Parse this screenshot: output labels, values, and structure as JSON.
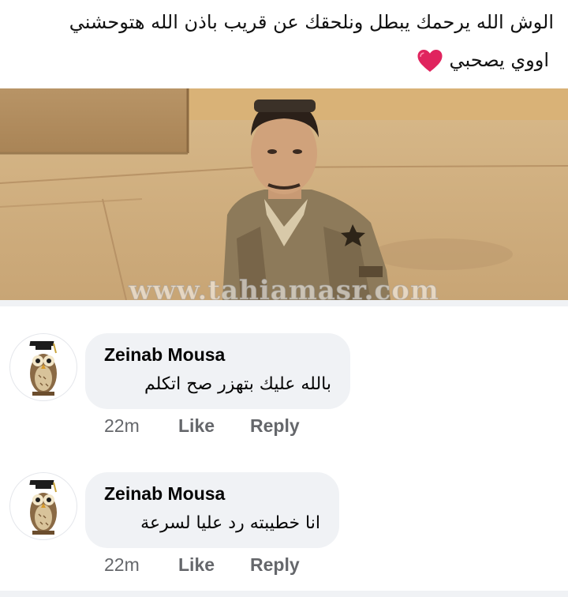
{
  "post": {
    "text_line1": "الوش  الله يرحمك يبطل ونلحقك عن قريب باذن الله هتوحشني",
    "text_line2": "اووي يصحبي",
    "heart_emoji": "red-heart-icon",
    "watermark": "www.tahiamasr.com"
  },
  "comments": [
    {
      "author": "Zeinab Mousa",
      "text": "بالله عليك بتهزر صح اتكلم",
      "time": "22m",
      "like_label": "Like",
      "reply_label": "Reply",
      "avatar_icon": "owl-graduate-avatar"
    },
    {
      "author": "Zeinab Mousa",
      "text": "انا خطيبته رد عليا لسرعة",
      "time": "22m",
      "like_label": "Like",
      "reply_label": "Reply",
      "avatar_icon": "owl-graduate-avatar"
    }
  ],
  "colors": {
    "bubble_bg": "#f0f2f5",
    "meta_text": "#65676b",
    "heart": "#e0245e"
  }
}
